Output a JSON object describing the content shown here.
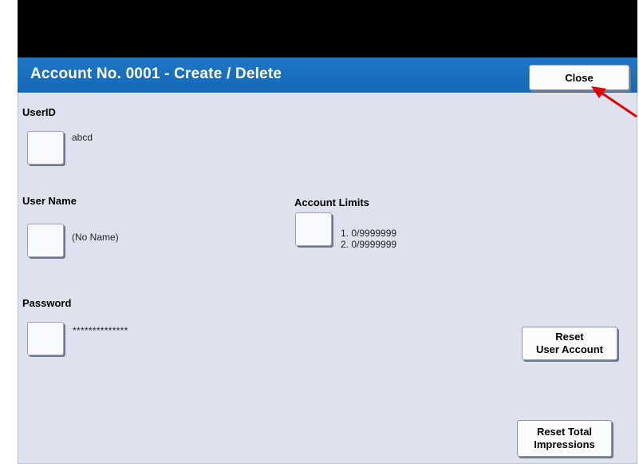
{
  "header": {
    "title": "Account No. 0001 - Create / Delete",
    "close_label": "Close"
  },
  "userid": {
    "label": "UserID",
    "value": "abcd"
  },
  "username": {
    "label": "User Name",
    "value": "(No Name)"
  },
  "password": {
    "label": "Password",
    "value": "**************"
  },
  "account_limits": {
    "label": "Account Limits",
    "line1": "1. 0/9999999",
    "line2": "2. 0/9999999"
  },
  "buttons": {
    "reset_user_account": {
      "line1": "Reset",
      "line2": "User Account"
    },
    "reset_total_impressions": {
      "line1": "Reset Total",
      "line2": "Impressions"
    }
  },
  "colors": {
    "title_bar": "#1a70c0",
    "panel": "#dde2ee",
    "annotation_arrow": "#e00000"
  }
}
